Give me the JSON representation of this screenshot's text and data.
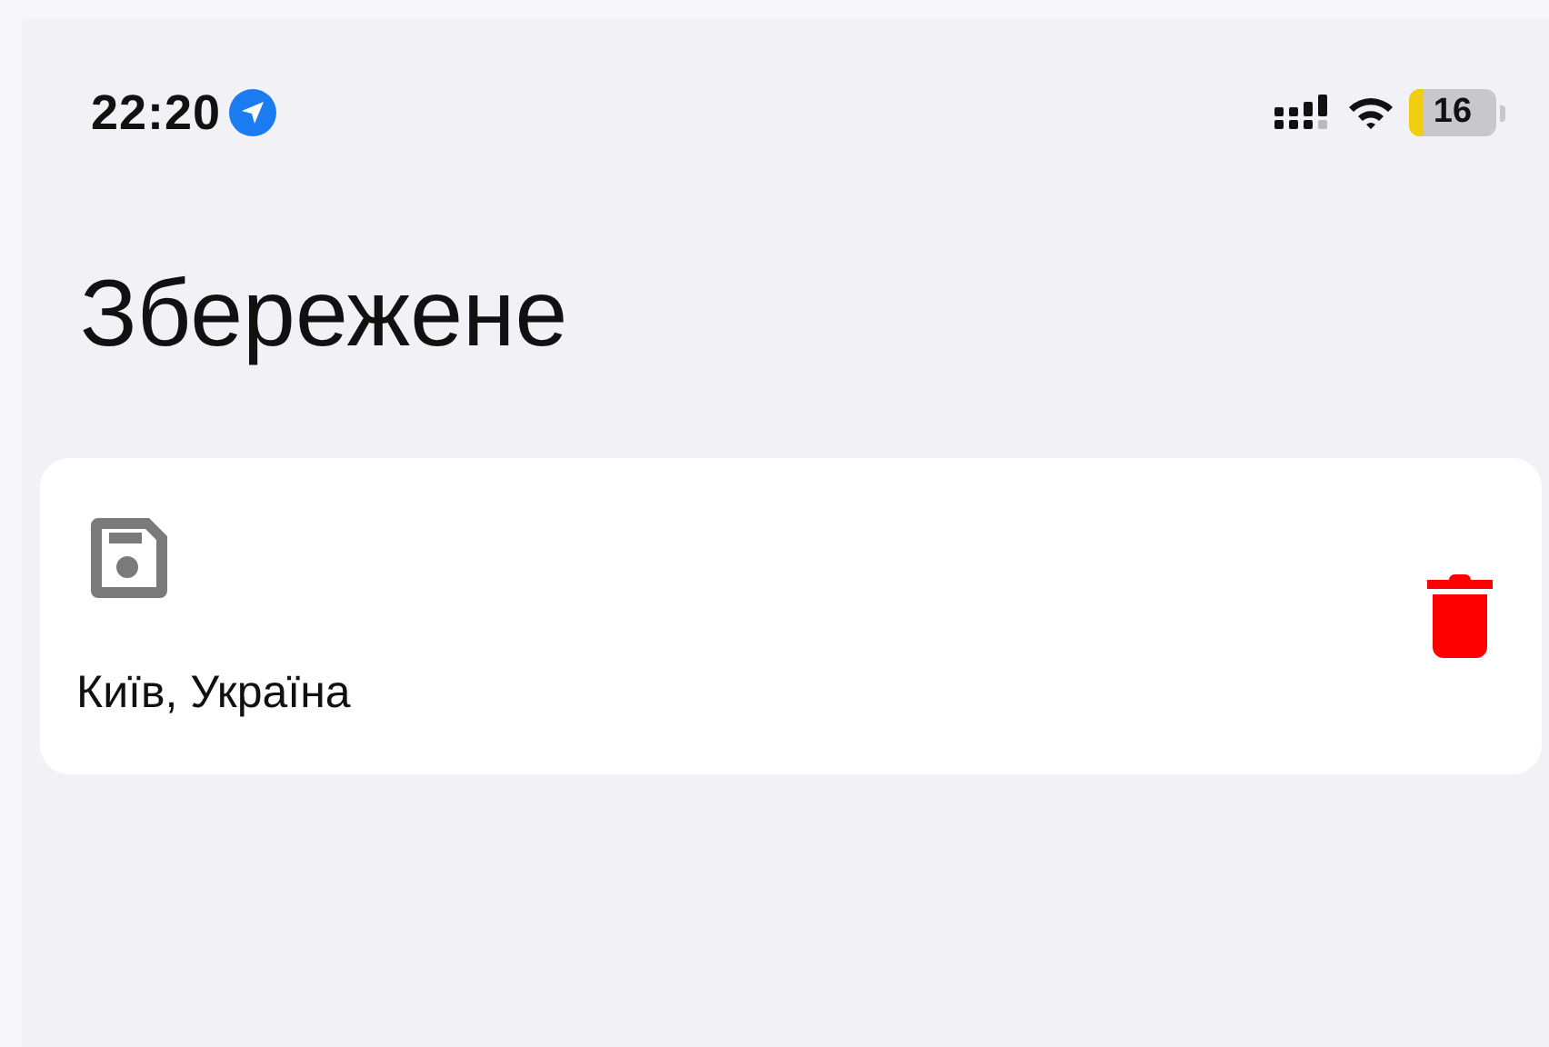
{
  "status_bar": {
    "time": "22:20",
    "battery": {
      "text": "16",
      "level": 0.16
    }
  },
  "title": "Збережене",
  "saved": [
    {
      "name": "Київ, Україна"
    }
  ]
}
